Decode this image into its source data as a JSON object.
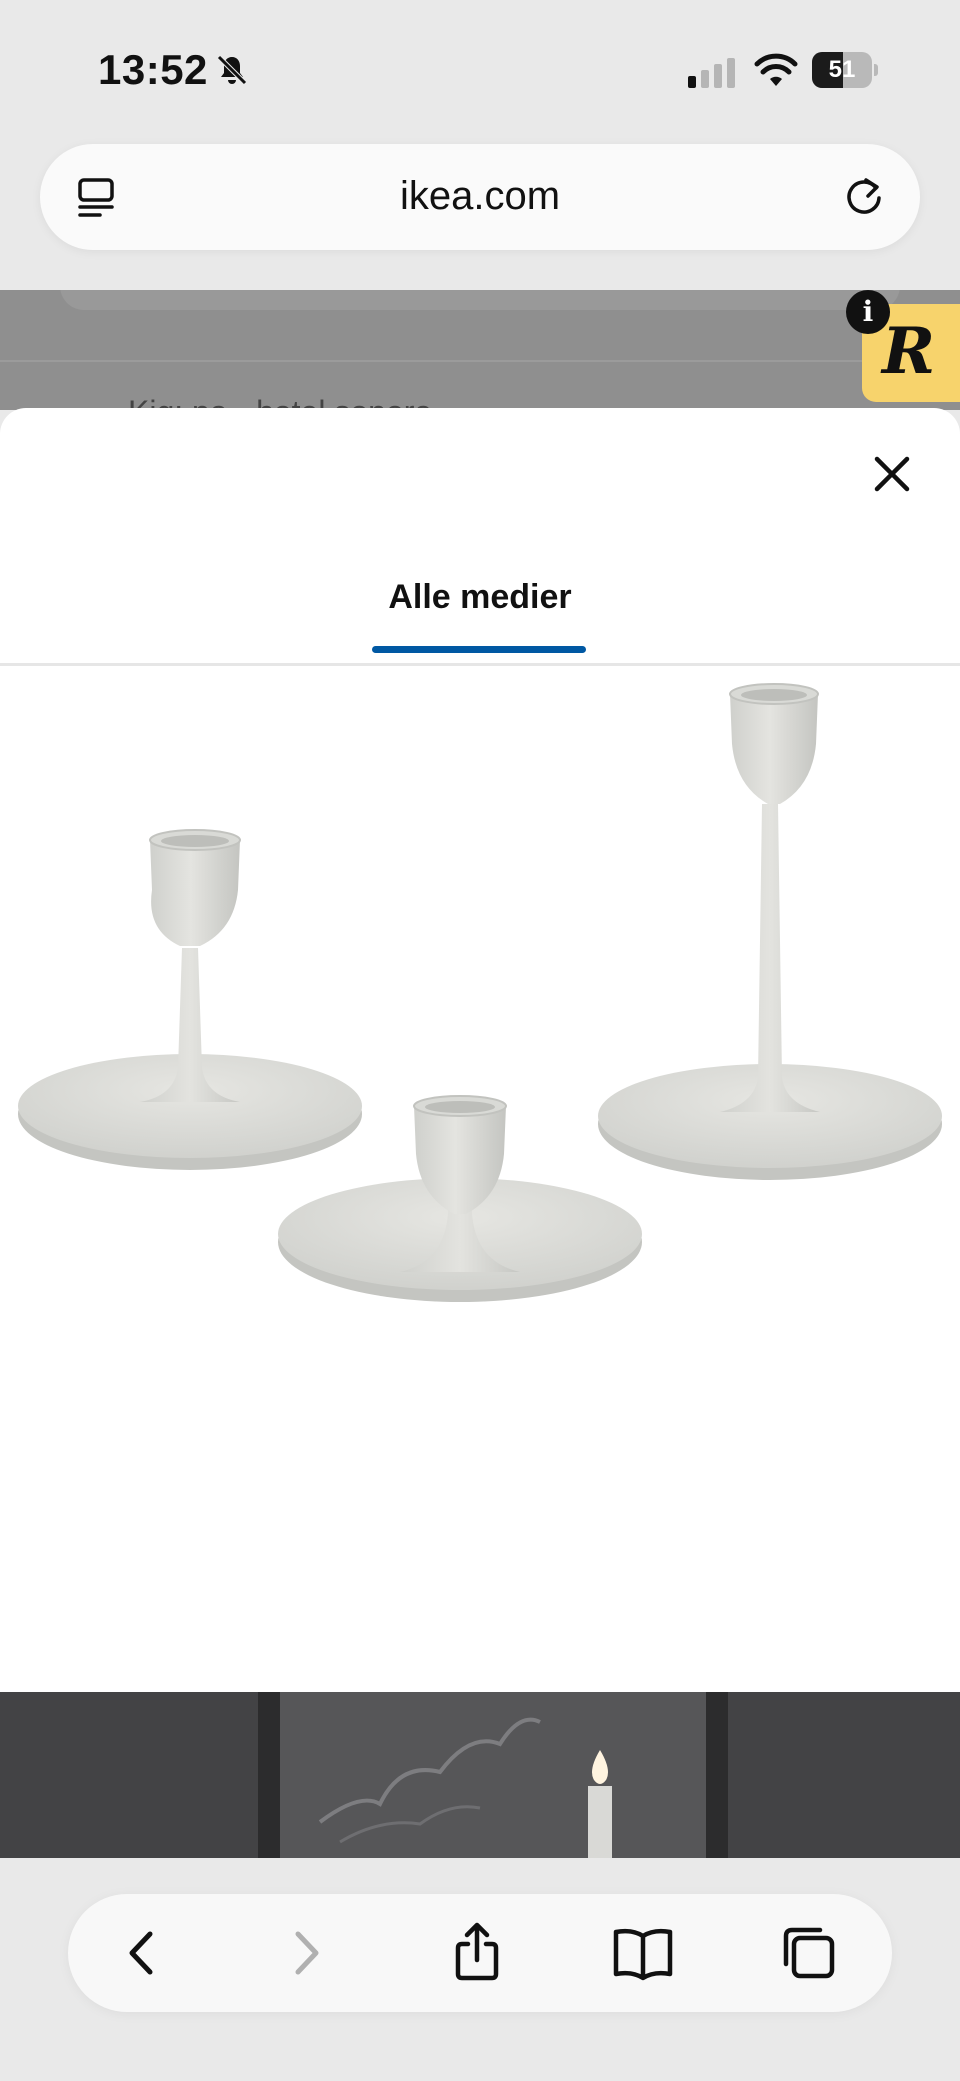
{
  "status_bar": {
    "time": "13:52",
    "battery_level": "51",
    "battery_fraction": 0.51
  },
  "browser": {
    "url": "ikea.com"
  },
  "background_page": {
    "partial_text": "Kig: pa - hotel sonora"
  },
  "extension_badge": {
    "letter": "R",
    "info_label": "i"
  },
  "modal": {
    "tab_label": "Alle medier",
    "product_image_alt": "Candle holders",
    "second_image_alt": "Candle in room"
  },
  "colors": {
    "accent": "#0058a3",
    "badge": "#f7d36c"
  },
  "icons": {
    "close": "close-icon",
    "tabs": "tabs-icon",
    "reload": "reload-icon",
    "back": "chevron-left-icon",
    "forward": "chevron-right-icon",
    "share": "share-icon",
    "bookmarks": "book-icon",
    "tab_switcher": "tabs-overview-icon"
  }
}
